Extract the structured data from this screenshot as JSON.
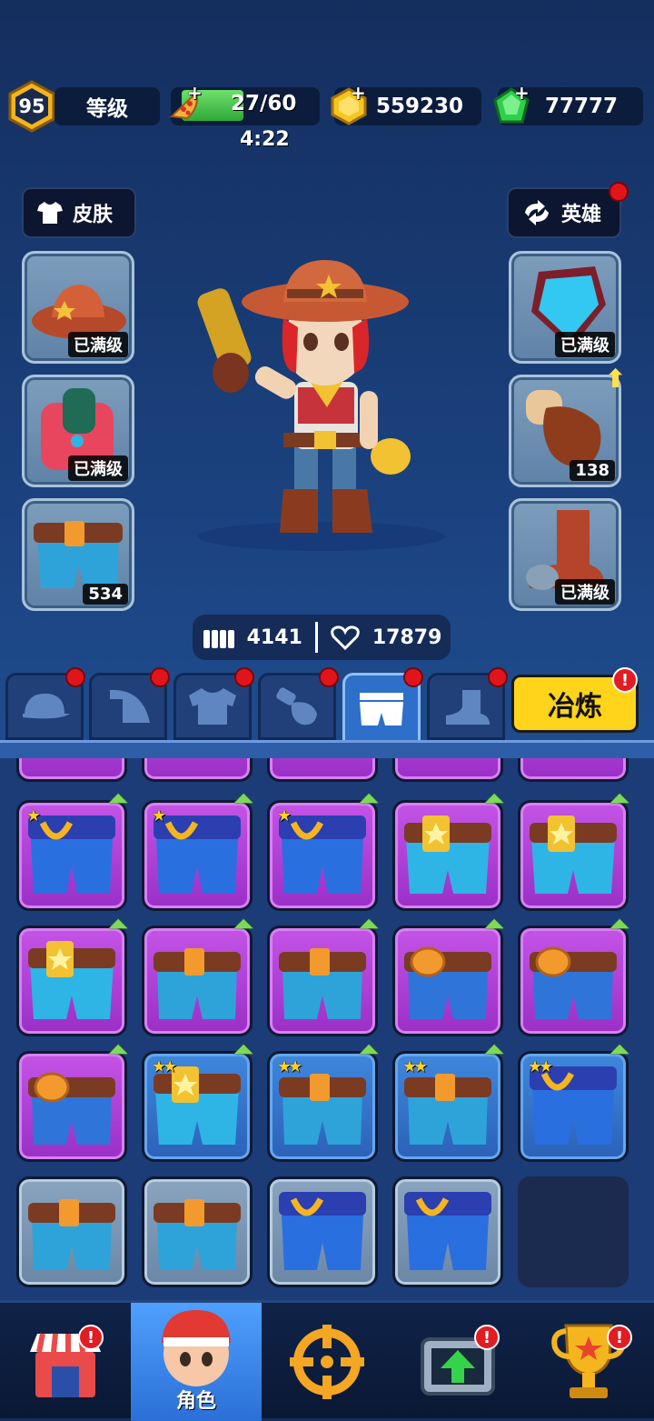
{
  "resources": {
    "level": "95",
    "level_label": "等级",
    "energy": "27/60",
    "energy_timer": "4:22",
    "energy_fill_fraction": 0.45,
    "gold": "559230",
    "gems": "77777"
  },
  "side_buttons": {
    "skins": "皮肤",
    "heroes": "英雄"
  },
  "equipment": {
    "left": [
      {
        "name": "cowboy-hat",
        "label": "已满级"
      },
      {
        "name": "vest",
        "label": "已满级"
      },
      {
        "name": "belt-shorts",
        "label": "534"
      }
    ],
    "right": [
      {
        "name": "shoulder-armor",
        "label": "已满级"
      },
      {
        "name": "glove",
        "label": "138"
      },
      {
        "name": "boot",
        "label": "已满级"
      }
    ]
  },
  "stats": {
    "ammo": "4141",
    "health": "17879"
  },
  "tabs": [
    "hat",
    "shoulder",
    "shirt",
    "glove",
    "pants",
    "boots"
  ],
  "smelt_button": "冶炼",
  "alert_mark": "!",
  "nav": {
    "role_label": "角色"
  },
  "items": [
    {
      "rarity": "purple",
      "type": "cop",
      "stars": 1,
      "upgrade": true
    },
    {
      "rarity": "purple",
      "type": "cop",
      "stars": 1,
      "upgrade": true
    },
    {
      "rarity": "purple",
      "type": "cop",
      "stars": 1,
      "upgrade": true
    },
    {
      "rarity": "purple",
      "type": "star",
      "stars": 0,
      "upgrade": true
    },
    {
      "rarity": "purple",
      "type": "star",
      "stars": 0,
      "upgrade": true
    },
    {
      "rarity": "purple",
      "type": "star",
      "stars": 0,
      "upgrade": true
    },
    {
      "rarity": "purple",
      "type": "square",
      "stars": 0,
      "upgrade": true
    },
    {
      "rarity": "purple",
      "type": "square",
      "stars": 0,
      "upgrade": true
    },
    {
      "rarity": "purple",
      "type": "round",
      "stars": 0,
      "upgrade": true
    },
    {
      "rarity": "purple",
      "type": "round",
      "stars": 0,
      "upgrade": true
    },
    {
      "rarity": "purple",
      "type": "round",
      "stars": 0,
      "upgrade": true
    },
    {
      "rarity": "blue",
      "type": "star",
      "stars": 2,
      "upgrade": true
    },
    {
      "rarity": "blue",
      "type": "square",
      "stars": 2,
      "upgrade": true
    },
    {
      "rarity": "blue",
      "type": "square",
      "stars": 2,
      "upgrade": true
    },
    {
      "rarity": "blue",
      "type": "cop",
      "stars": 2,
      "upgrade": true
    },
    {
      "rarity": "gray",
      "type": "square",
      "stars": 0,
      "upgrade": false
    },
    {
      "rarity": "gray",
      "type": "square",
      "stars": 0,
      "upgrade": false
    },
    {
      "rarity": "gray",
      "type": "cop",
      "stars": 0,
      "upgrade": false
    },
    {
      "rarity": "gray",
      "type": "cop",
      "stars": 0,
      "upgrade": false
    },
    {
      "rarity": "empty",
      "type": "none",
      "stars": 0,
      "upgrade": false
    }
  ]
}
